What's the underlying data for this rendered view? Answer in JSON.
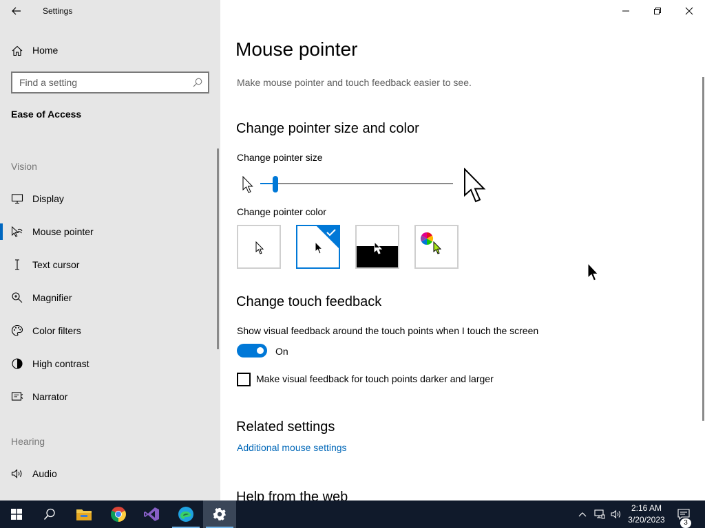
{
  "window": {
    "title": "Settings"
  },
  "sidebar": {
    "home_label": "Home",
    "search_placeholder": "Find a setting",
    "category": "Ease of Access",
    "vision_header": "Vision",
    "hearing_header": "Hearing",
    "items": [
      {
        "label": "Display",
        "icon": "monitor-icon"
      },
      {
        "label": "Mouse pointer",
        "icon": "mouse-pointer-icon",
        "selected": true
      },
      {
        "label": "Text cursor",
        "icon": "text-cursor-icon"
      },
      {
        "label": "Magnifier",
        "icon": "magnifier-icon"
      },
      {
        "label": "Color filters",
        "icon": "palette-icon"
      },
      {
        "label": "High contrast",
        "icon": "high-contrast-icon"
      },
      {
        "label": "Narrator",
        "icon": "narrator-icon"
      },
      {
        "label": "Audio",
        "icon": "speaker-icon"
      }
    ]
  },
  "main": {
    "title": "Mouse pointer",
    "description": "Make mouse pointer and touch feedback easier to see.",
    "size_color_header": "Change pointer size and color",
    "pointer_size_label": "Change pointer size",
    "pointer_size_value": 1,
    "pointer_color_label": "Change pointer color",
    "color_options": [
      "white",
      "black",
      "inverted",
      "custom"
    ],
    "selected_color": "black",
    "touch_header": "Change touch feedback",
    "touch_label": "Show visual feedback around the touch points when I touch the screen",
    "toggle_state": "On",
    "checkbox_label": "Make visual feedback for touch points darker and larger",
    "checkbox_checked": false,
    "related_header": "Related settings",
    "related_link": "Additional mouse settings",
    "help_header": "Help from the web"
  },
  "taskbar": {
    "time": "2:16 AM",
    "date": "3/20/2023",
    "notification_count": "3",
    "accent": "#0078d7",
    "apps": [
      "start",
      "search",
      "file-explorer",
      "chrome",
      "visual-studio",
      "edge",
      "settings"
    ]
  }
}
